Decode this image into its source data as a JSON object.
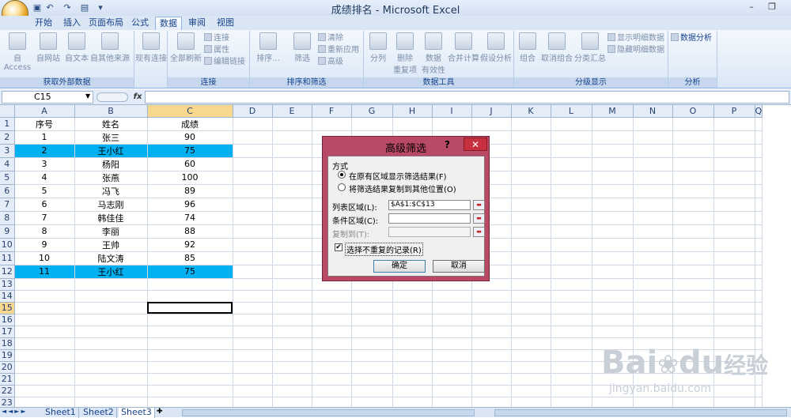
{
  "app": {
    "title": "成绩排名 - Microsoft Excel"
  },
  "tabs": [
    "开始",
    "插入",
    "页面布局",
    "公式",
    "数据",
    "审阅",
    "视图"
  ],
  "ribbon": {
    "groups": [
      "获取外部数据",
      "连接",
      "排序和筛选",
      "数据工具",
      "分级显示",
      "分析"
    ],
    "ext": [
      "自 Access",
      "自网站",
      "自文本",
      "自其他来源",
      "现有连接"
    ],
    "conn": {
      "refresh": "全部刷新",
      "links": [
        "连接",
        "属性",
        "编辑链接"
      ]
    },
    "sort": {
      "sort": "排序...",
      "filter": "筛选",
      "links": [
        "清除",
        "重新应用",
        "高级"
      ]
    },
    "tools": [
      "分列",
      "删除\n重复项",
      "数据\n有效性",
      "合并计算",
      "假设分析"
    ],
    "outline": [
      "组合",
      "取消组合",
      "分类汇总"
    ],
    "outline_links": [
      "显示明细数据",
      "隐藏明细数据"
    ],
    "analysis": "数据分析"
  },
  "formula": {
    "namebox": "C15",
    "fx": "fx"
  },
  "columns": [
    "A",
    "B",
    "C",
    "D",
    "E",
    "F",
    "G",
    "H",
    "I",
    "J",
    "K",
    "L",
    "M",
    "N",
    "O",
    "P",
    "Q"
  ],
  "rows": [
    [
      "序号",
      "姓名",
      "成绩"
    ],
    [
      "1",
      "张三",
      "90"
    ],
    [
      "2",
      "王小红",
      "75"
    ],
    [
      "3",
      "杨阳",
      "60"
    ],
    [
      "4",
      "张燕",
      "100"
    ],
    [
      "5",
      "冯飞",
      "89"
    ],
    [
      "6",
      "马志刚",
      "96"
    ],
    [
      "7",
      "韩佳佳",
      "74"
    ],
    [
      "8",
      "李丽",
      "88"
    ],
    [
      "9",
      "王帅",
      "92"
    ],
    [
      "10",
      "陆文涛",
      "85"
    ],
    [
      "11",
      "王小红",
      "75"
    ]
  ],
  "row_count": 25,
  "highlight_color": "#00b0f0",
  "sheets": [
    "Sheet1",
    "Sheet2",
    "Sheet3"
  ],
  "dialog": {
    "title": "高级筛选",
    "help": "?",
    "close": "✕",
    "mode_label": "方式",
    "opt1": "在原有区域显示筛选结果(F)",
    "opt2": "将筛选结果复制到其他位置(O)",
    "list_label": "列表区域(L):",
    "list_value": "$A$1:$C$13",
    "criteria_label": "条件区域(C):",
    "criteria_value": "",
    "copy_label": "复制到(T):",
    "copy_value": "",
    "unique_label": "选择不重复的记录(R)",
    "ok": "确定",
    "cancel": "取消"
  },
  "watermark": {
    "brand": "Bai",
    "brand2": "du",
    "suffix": "经验",
    "url": "jingyan.baidu.com"
  }
}
